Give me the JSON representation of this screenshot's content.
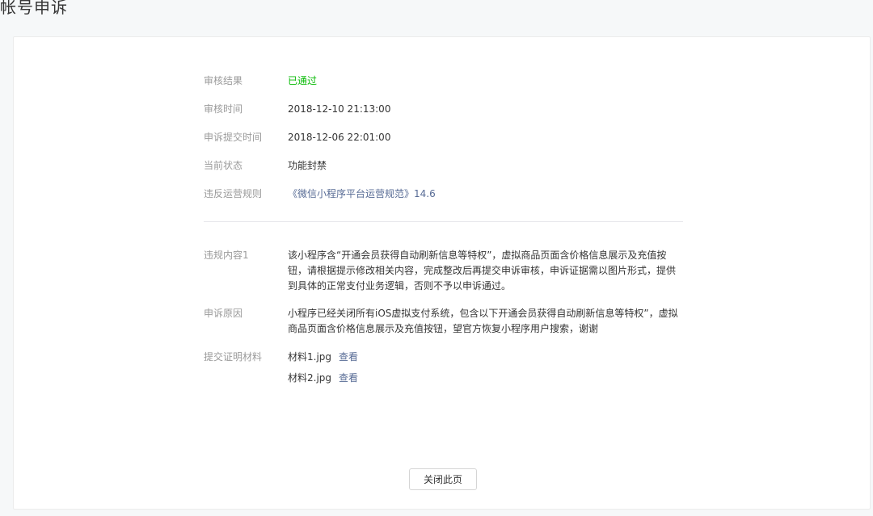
{
  "header": {
    "title": "帐号申诉"
  },
  "review": {
    "result_label": "审核结果",
    "result_value": "已通过",
    "time_label": "审核时间",
    "time_value": "2018-12-10 21:13:00",
    "submit_time_label": "申诉提交时间",
    "submit_time_value": "2018-12-06 22:01:00",
    "status_label": "当前状态",
    "status_value": "功能封禁",
    "rule_label": "违反运营规则",
    "rule_value": "《微信小程序平台运营规范》14.6"
  },
  "violation": {
    "label": "违规内容1",
    "text": "该小程序含“开通会员获得自动刷新信息等特权”，虚拟商品页面含价格信息展示及充值按钮，请根据提示修改相关内容，完成整改后再提交申诉审核，申诉证据需以图片形式，提供到具体的正常支付业务逻辑，否则不予以申诉通过。"
  },
  "appeal": {
    "label": "申诉原因",
    "text": "小程序已经关闭所有iOS虚拟支付系统，包含以下开通会员获得自动刷新信息等特权”，虚拟商品页面含价格信息展示及充值按钮，望官方恢复小程序用户搜索，谢谢"
  },
  "materials": {
    "label": "提交证明材料",
    "files": [
      {
        "name": "材料1.jpg",
        "action": "查看"
      },
      {
        "name": "材料2.jpg",
        "action": "查看"
      }
    ]
  },
  "footer": {
    "close_label": "关闭此页"
  },
  "colors": {
    "success": "#09bb07",
    "link": "#576b95",
    "label": "#9a9a9a"
  }
}
